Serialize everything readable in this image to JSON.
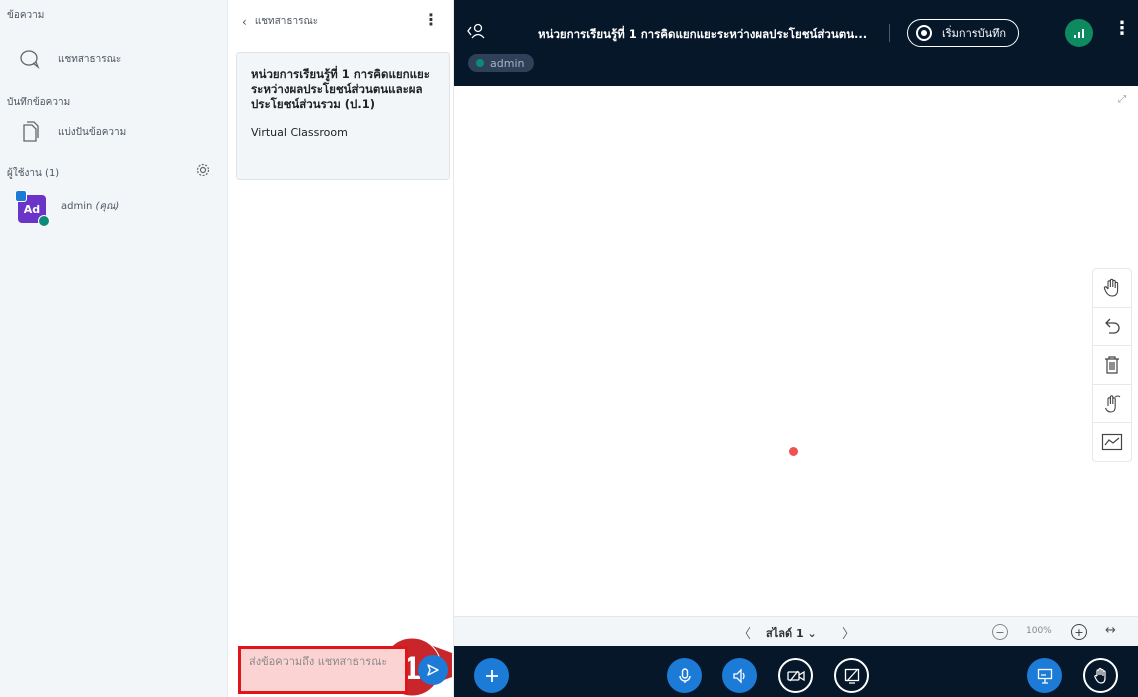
{
  "sidebar": {
    "messages_heading": "ข้อความ",
    "public_chat_label": "แชทสาธารณะ",
    "notes_heading": "บันทึกข้อความ",
    "shared_notes_label": "แบ่งปันข้อความ",
    "users_heading": "ผู้ใช้งาน (1)",
    "user": {
      "avatar": "Ad",
      "name": "admin",
      "you_suffix": "(คุณ)"
    }
  },
  "chat": {
    "header": "แชทสาธารณะ",
    "welcome_title": "หน่วยการเรียนรู้ที่ 1 การคิดแยกแยะระหว่างผลประโยชน์ส่วนตนและผลประโยชน์ส่วนรวม (ป.1)",
    "welcome_subtitle": "Virtual Classroom",
    "input_placeholder": "ส่งข้อความถึง แชทสาธารณะ",
    "step_number": "1"
  },
  "presentation": {
    "title": "หน่วยการเรียนรู้ที่ 1 การคิดแยกแยะระหว่างผลประโยชน์ส่วนตน...",
    "record_label": "เริ่มการบันทึก",
    "presenter_badge": "admin",
    "slide_label": "สไลด์ 1",
    "zoom_value": "100%"
  },
  "colors": {
    "accent": "#1d7bd8",
    "topbar": "#06172a",
    "highlight": "#e0151a",
    "badge": "#c9262b"
  },
  "icons": [
    "chat-icon",
    "notes-icon",
    "gear-icon",
    "hand-icon",
    "undo-icon",
    "trash-icon",
    "multi-user-icon",
    "whiteboard-icon",
    "microphone-icon",
    "speaker-icon",
    "camera-off-icon",
    "screen-share-off-icon",
    "presentation-icon",
    "raise-hand-icon"
  ]
}
